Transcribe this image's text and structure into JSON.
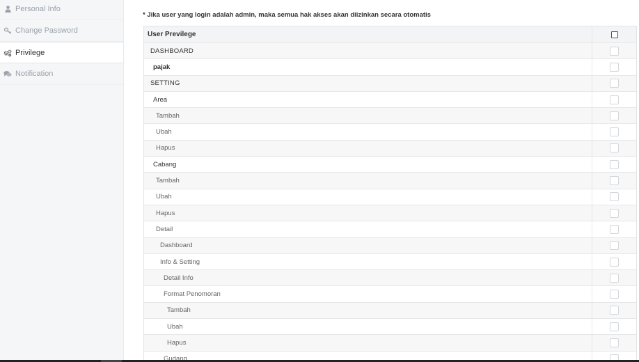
{
  "sidebar": {
    "items": [
      {
        "label": "Personal Info",
        "icon": "user-icon"
      },
      {
        "label": "Change Password",
        "icon": "key-icon"
      },
      {
        "label": "Privilege",
        "icon": "gears-icon"
      },
      {
        "label": "Notification",
        "icon": "comments-icon"
      }
    ]
  },
  "notice": "* Jika user yang login adalah admin, maka semua hak akses akan diizinkan secara otomatis",
  "table": {
    "header": "User Previlege",
    "rows": [
      {
        "label": "DASHBOARD"
      },
      {
        "label": "pajak"
      },
      {
        "label": "SETTING"
      },
      {
        "label": "Area"
      },
      {
        "label": "Tambah"
      },
      {
        "label": "Ubah"
      },
      {
        "label": "Hapus"
      },
      {
        "label": "Cabang"
      },
      {
        "label": "Tambah"
      },
      {
        "label": "Ubah"
      },
      {
        "label": "Hapus"
      },
      {
        "label": "Detail"
      },
      {
        "label": "Dashboard"
      },
      {
        "label": "Info & Setting"
      },
      {
        "label": "Detail Info"
      },
      {
        "label": "Format Penomoran"
      },
      {
        "label": "Tambah"
      },
      {
        "label": "Ubah"
      },
      {
        "label": "Hapus"
      },
      {
        "label": "Gudang"
      }
    ]
  },
  "colors": {
    "sidebar_bg": "#f5f6f8",
    "text_muted": "#9aa2ab",
    "text_main": "#333333"
  }
}
